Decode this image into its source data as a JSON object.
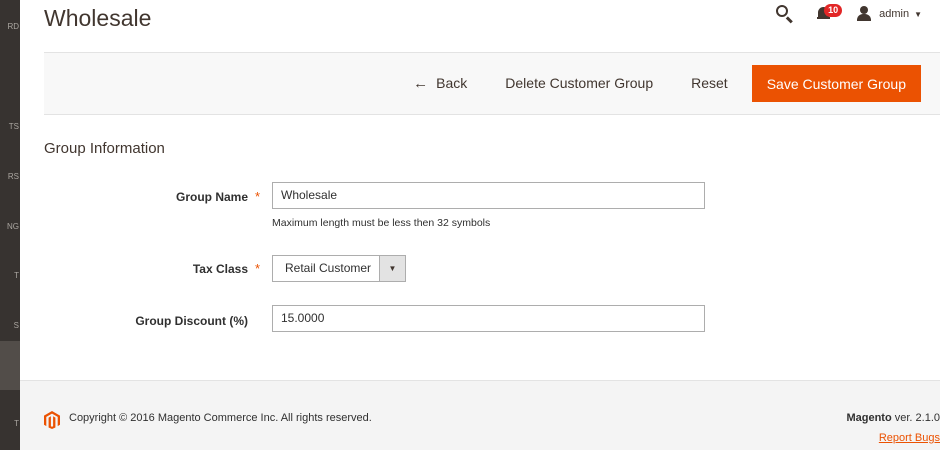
{
  "sidebar": {
    "items": [
      "RD",
      "TS",
      "RS",
      "NG",
      "T",
      "S",
      "T"
    ]
  },
  "header": {
    "title": "Wholesale",
    "notifications_count": "10",
    "user_name": "admin"
  },
  "actions": {
    "back": "Back",
    "delete": "Delete Customer Group",
    "reset": "Reset",
    "save": "Save Customer Group"
  },
  "form": {
    "section_title": "Group Information",
    "group_name": {
      "label": "Group Name",
      "value": "Wholesale",
      "note": "Maximum length must be less then 32 symbols"
    },
    "tax_class": {
      "label": "Tax Class",
      "selected": "Retail Customer"
    },
    "group_discount": {
      "label": "Group Discount (%)",
      "value": "15.0000"
    }
  },
  "footer": {
    "copyright": "Copyright © 2016 Magento Commerce Inc. All rights reserved.",
    "brand": "Magento",
    "version": " ver. 2.1.0",
    "report_bugs": "Report Bugs"
  },
  "colors": {
    "accent": "#eb5202",
    "sidebar": "#373330",
    "badge": "#e22626"
  }
}
